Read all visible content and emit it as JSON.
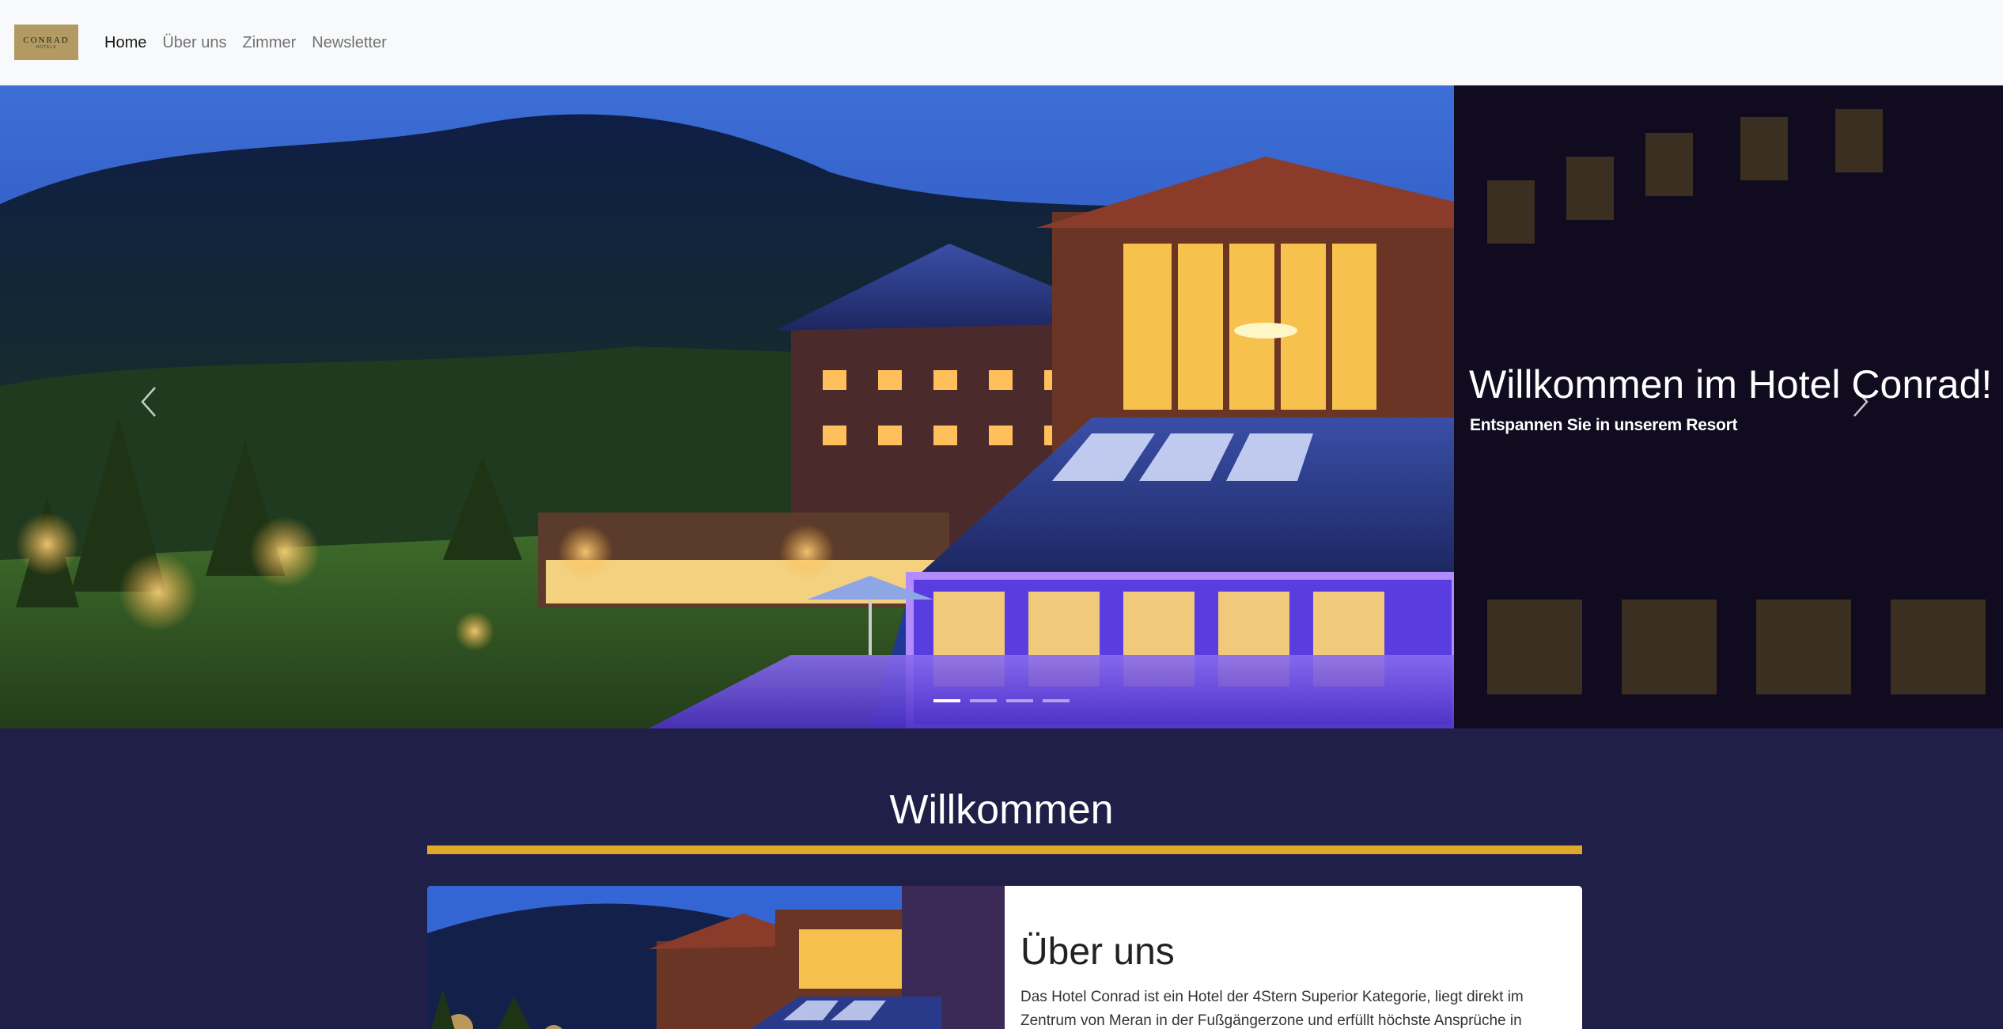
{
  "navbar": {
    "logo": {
      "word": "CONRAD",
      "sub": "HOTELS"
    },
    "items": [
      {
        "label": "Home",
        "active": true
      },
      {
        "label": "Über uns"
      },
      {
        "label": "Zimmer"
      },
      {
        "label": "Newsletter"
      }
    ]
  },
  "carousel": {
    "caption_title": "Willkommen im Hotel Conrad!",
    "caption_subtitle": "Entspannen Sie in unserem Resort",
    "indicator_count": 4,
    "active_index": 0,
    "prev_icon": "chevron-left-icon",
    "next_icon": "chevron-right-icon"
  },
  "welcome": {
    "title": "Willkommen",
    "accent_color": "#e0a829"
  },
  "about_card": {
    "title": "Über uns",
    "text": "Das Hotel Conrad ist ein Hotel der 4Stern Superior Kategorie, liegt direkt im Zentrum von Meran in der Fußgängerzone und erfüllt höchste Ansprüche in"
  },
  "colors": {
    "navbar_bg": "#f8f9fa",
    "page_bg": "#1f1f47",
    "gold": "#e0a829"
  }
}
